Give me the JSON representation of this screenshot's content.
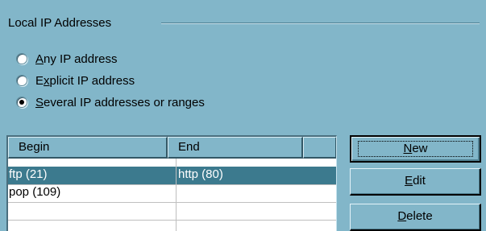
{
  "group": {
    "title": "Local IP Addresses"
  },
  "radios": [
    {
      "label_prefix": "",
      "label_accel": "A",
      "label_rest": "ny IP address",
      "selected": false
    },
    {
      "label_prefix": "E",
      "label_accel": "x",
      "label_rest": "plicit IP address",
      "selected": false
    },
    {
      "label_prefix": "",
      "label_accel": "S",
      "label_rest": "everal IP addresses or ranges",
      "selected": true
    }
  ],
  "list": {
    "columns": [
      "Begin",
      "End",
      ""
    ],
    "rows": [
      {
        "begin": "ftp (21)",
        "end": "http (80)",
        "selected": true
      },
      {
        "begin": "pop (109)",
        "end": "",
        "selected": false
      },
      {
        "begin": "",
        "end": "",
        "selected": false
      }
    ]
  },
  "buttons": {
    "new_accel": "N",
    "new_rest": "ew",
    "edit_accel": "E",
    "edit_rest": "dit",
    "delete_accel": "D",
    "delete_rest": "elete"
  }
}
